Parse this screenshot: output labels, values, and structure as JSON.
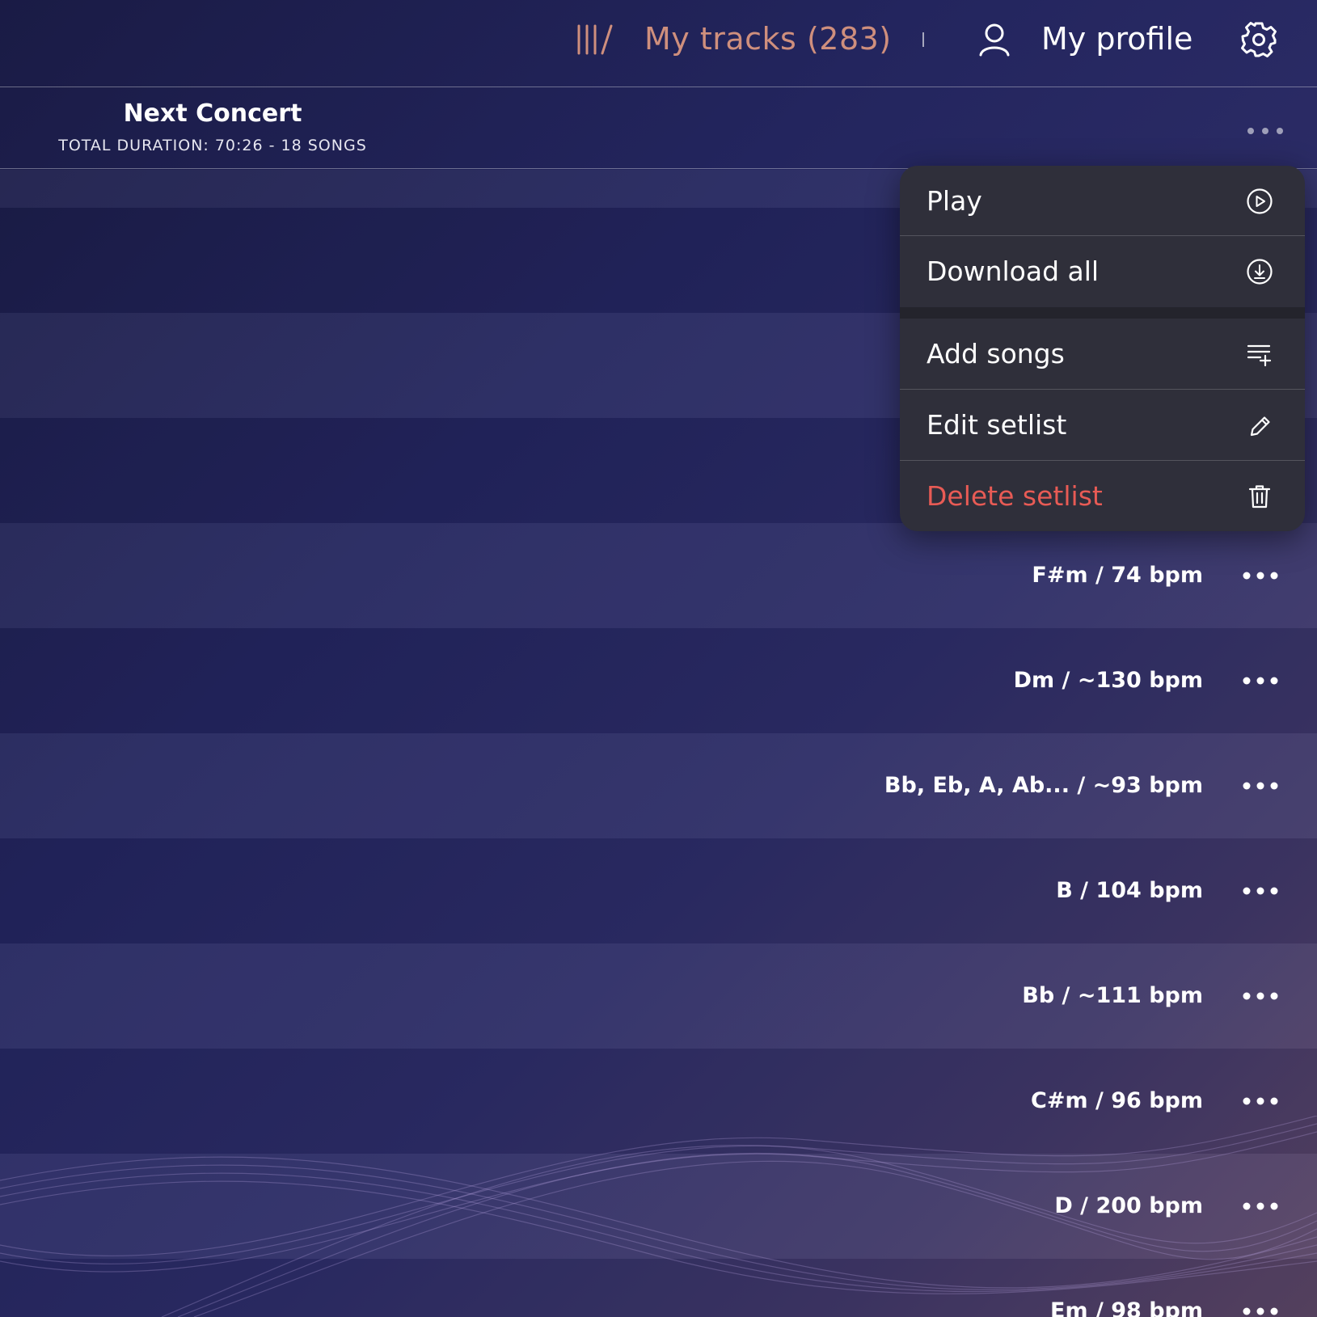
{
  "header": {
    "tracks_label": "My tracks (283)",
    "profile_label": "My profile"
  },
  "setlist": {
    "title": "Next Concert",
    "summary": "TOTAL DURATION: 70:26 - 18 SONGS"
  },
  "context_menu": {
    "items": [
      {
        "label": "Play",
        "icon": "play-circle-icon"
      },
      {
        "label": "Download all",
        "icon": "download-circle-icon"
      },
      {
        "label": "Add songs",
        "icon": "playlist-add-icon"
      },
      {
        "label": "Edit setlist",
        "icon": "pencil-icon"
      },
      {
        "label": "Delete setlist",
        "icon": "trash-icon"
      }
    ]
  },
  "songs": [
    {
      "meta": "F#m / 74 bpm"
    },
    {
      "meta": "Dm / ~130 bpm"
    },
    {
      "meta": "Bb, Eb, A, Ab... / ~93 bpm"
    },
    {
      "meta": "B / 104 bpm"
    },
    {
      "meta": "Bb / ~111 bpm"
    },
    {
      "meta": "C#m / 96 bpm"
    },
    {
      "meta": "D / 200 bpm"
    },
    {
      "meta": "Em / 98 bpm"
    }
  ],
  "colors": {
    "accent_tracks": "#cf8f7d",
    "danger": "#e85b55",
    "menu_bg": "#2f2f3a"
  }
}
